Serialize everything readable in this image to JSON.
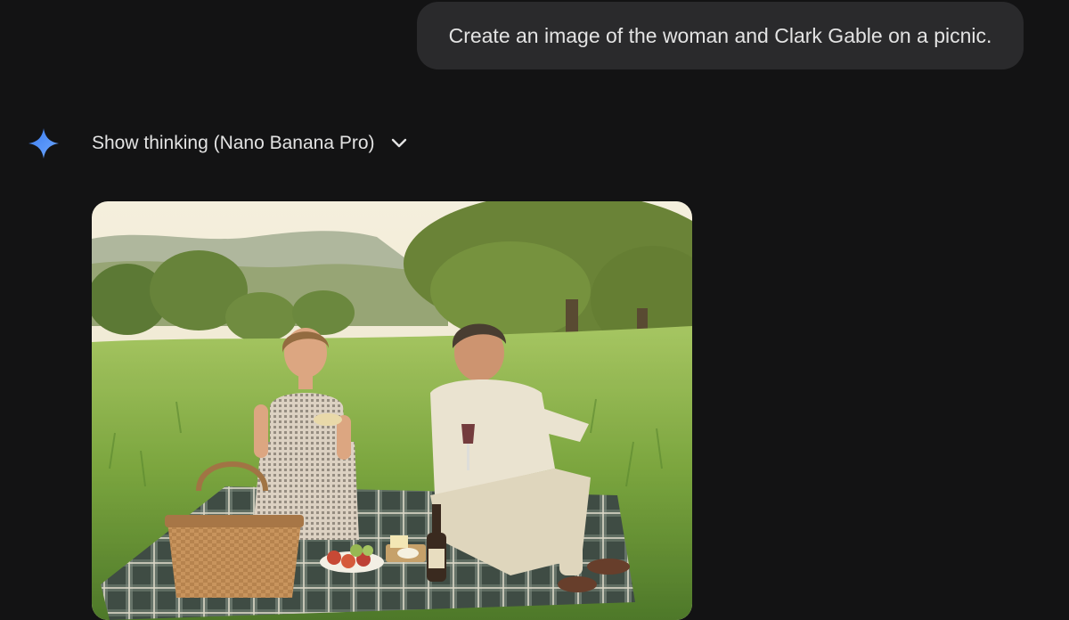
{
  "conversation": {
    "user_message": "Create an image of the woman and Clark Gable on a picnic.",
    "response": {
      "thinking_toggle_label": "Show thinking (Nano Banana Pro)",
      "spark_icon": "gemini-spark-icon",
      "chevron_icon": "chevron-down-icon",
      "image_alt": "Generated image: a woman and a man having a picnic on a plaid blanket in a grassy meadow with oak trees and hills"
    }
  },
  "colors": {
    "background": "#131314",
    "bubble": "#2a2a2c",
    "text": "#e3e3e3",
    "spark_accent": "#4a8cf7"
  }
}
